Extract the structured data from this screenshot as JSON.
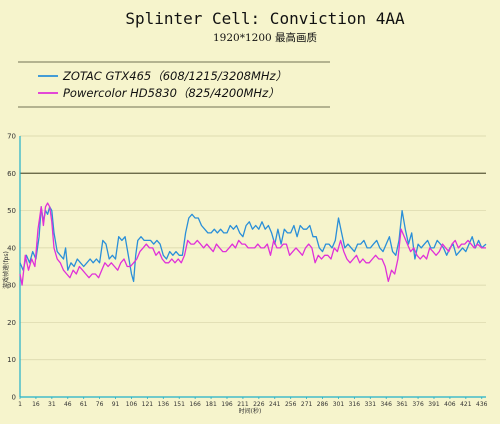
{
  "chart_data": {
    "type": "line",
    "title": "Splinter Cell: Conviction 4AA",
    "subtitle": "1920*1200 最高画质",
    "xlabel": "时间(秒)",
    "ylabel": "游戏帧速(fps)",
    "xlim": [
      1,
      440
    ],
    "ylim": [
      0,
      70
    ],
    "yticks": [
      0,
      10,
      20,
      30,
      40,
      50,
      60,
      70
    ],
    "xtick_labels": [
      "1",
      "16",
      "31",
      "46",
      "61",
      "76",
      "91",
      "106",
      "121",
      "136",
      "151",
      "166",
      "181",
      "196",
      "211",
      "226",
      "241",
      "256",
      "271",
      "286",
      "301",
      "316",
      "331",
      "346",
      "361",
      "376",
      "391",
      "406",
      "421",
      "436"
    ],
    "reference_line": 60,
    "grid": "horizontal",
    "legend_position": "top-left",
    "series": [
      {
        "name": "ZOTAC GTX465（608/1215/3208MHz）",
        "color": "#2a8fd8",
        "points": [
          [
            1,
            36
          ],
          [
            4,
            34
          ],
          [
            7,
            38
          ],
          [
            10,
            36
          ],
          [
            13,
            39
          ],
          [
            16,
            37
          ],
          [
            19,
            43
          ],
          [
            21,
            51
          ],
          [
            23,
            47
          ],
          [
            25,
            50
          ],
          [
            27,
            49
          ],
          [
            29,
            51
          ],
          [
            31,
            50
          ],
          [
            33,
            44
          ],
          [
            36,
            39
          ],
          [
            39,
            38
          ],
          [
            42,
            37
          ],
          [
            44,
            40
          ],
          [
            46,
            34
          ],
          [
            49,
            36
          ],
          [
            52,
            35
          ],
          [
            55,
            37
          ],
          [
            58,
            36
          ],
          [
            61,
            35
          ],
          [
            64,
            36
          ],
          [
            67,
            37
          ],
          [
            70,
            36
          ],
          [
            73,
            37
          ],
          [
            76,
            36
          ],
          [
            79,
            42
          ],
          [
            82,
            41
          ],
          [
            85,
            37
          ],
          [
            88,
            38
          ],
          [
            91,
            37
          ],
          [
            94,
            43
          ],
          [
            97,
            42
          ],
          [
            100,
            43
          ],
          [
            103,
            38
          ],
          [
            106,
            33
          ],
          [
            108,
            31
          ],
          [
            110,
            38
          ],
          [
            112,
            42
          ],
          [
            115,
            43
          ],
          [
            118,
            42
          ],
          [
            121,
            42
          ],
          [
            124,
            42
          ],
          [
            127,
            41
          ],
          [
            130,
            42
          ],
          [
            133,
            41
          ],
          [
            136,
            38
          ],
          [
            139,
            37
          ],
          [
            142,
            39
          ],
          [
            145,
            38
          ],
          [
            148,
            39
          ],
          [
            151,
            38
          ],
          [
            154,
            38
          ],
          [
            157,
            44
          ],
          [
            160,
            48
          ],
          [
            163,
            49
          ],
          [
            166,
            48
          ],
          [
            169,
            48
          ],
          [
            172,
            46
          ],
          [
            175,
            45
          ],
          [
            178,
            44
          ],
          [
            181,
            44
          ],
          [
            184,
            45
          ],
          [
            187,
            44
          ],
          [
            190,
            45
          ],
          [
            193,
            44
          ],
          [
            196,
            44
          ],
          [
            199,
            46
          ],
          [
            202,
            45
          ],
          [
            205,
            46
          ],
          [
            208,
            44
          ],
          [
            211,
            43
          ],
          [
            214,
            46
          ],
          [
            217,
            47
          ],
          [
            220,
            45
          ],
          [
            223,
            46
          ],
          [
            226,
            45
          ],
          [
            229,
            47
          ],
          [
            232,
            45
          ],
          [
            235,
            46
          ],
          [
            238,
            44
          ],
          [
            241,
            41
          ],
          [
            244,
            45
          ],
          [
            247,
            41
          ],
          [
            250,
            45
          ],
          [
            253,
            44
          ],
          [
            256,
            44
          ],
          [
            259,
            46
          ],
          [
            262,
            43
          ],
          [
            265,
            46
          ],
          [
            268,
            45
          ],
          [
            271,
            45
          ],
          [
            274,
            46
          ],
          [
            277,
            43
          ],
          [
            280,
            43
          ],
          [
            283,
            40
          ],
          [
            286,
            39
          ],
          [
            289,
            41
          ],
          [
            292,
            41
          ],
          [
            295,
            40
          ],
          [
            298,
            42
          ],
          [
            301,
            48
          ],
          [
            304,
            44
          ],
          [
            307,
            40
          ],
          [
            310,
            41
          ],
          [
            313,
            40
          ],
          [
            316,
            39
          ],
          [
            319,
            41
          ],
          [
            322,
            41
          ],
          [
            325,
            42
          ],
          [
            328,
            40
          ],
          [
            331,
            40
          ],
          [
            334,
            41
          ],
          [
            337,
            42
          ],
          [
            340,
            40
          ],
          [
            343,
            39
          ],
          [
            346,
            41
          ],
          [
            349,
            43
          ],
          [
            352,
            39
          ],
          [
            355,
            38
          ],
          [
            358,
            42
          ],
          [
            361,
            50
          ],
          [
            364,
            45
          ],
          [
            367,
            41
          ],
          [
            370,
            44
          ],
          [
            373,
            37
          ],
          [
            376,
            41
          ],
          [
            379,
            40
          ],
          [
            382,
            41
          ],
          [
            385,
            42
          ],
          [
            388,
            40
          ],
          [
            391,
            40
          ],
          [
            394,
            42
          ],
          [
            397,
            41
          ],
          [
            400,
            40
          ],
          [
            403,
            38
          ],
          [
            406,
            40
          ],
          [
            409,
            41
          ],
          [
            412,
            38
          ],
          [
            415,
            39
          ],
          [
            418,
            40
          ],
          [
            421,
            39
          ],
          [
            424,
            41
          ],
          [
            427,
            43
          ],
          [
            430,
            40
          ],
          [
            433,
            42
          ],
          [
            436,
            40
          ],
          [
            440,
            41
          ]
        ]
      },
      {
        "name": "Powercolor HD5830（825/4200MHz）",
        "color": "#e030d8",
        "points": [
          [
            1,
            33
          ],
          [
            3,
            30
          ],
          [
            6,
            38
          ],
          [
            9,
            34
          ],
          [
            12,
            37
          ],
          [
            15,
            35
          ],
          [
            18,
            45
          ],
          [
            21,
            51
          ],
          [
            23,
            46
          ],
          [
            25,
            51
          ],
          [
            27,
            52
          ],
          [
            29,
            51
          ],
          [
            31,
            47
          ],
          [
            33,
            40
          ],
          [
            36,
            37
          ],
          [
            39,
            36
          ],
          [
            42,
            34
          ],
          [
            45,
            33
          ],
          [
            48,
            32
          ],
          [
            51,
            34
          ],
          [
            54,
            33
          ],
          [
            57,
            35
          ],
          [
            60,
            34
          ],
          [
            63,
            33
          ],
          [
            66,
            32
          ],
          [
            69,
            33
          ],
          [
            72,
            33
          ],
          [
            75,
            32
          ],
          [
            78,
            34
          ],
          [
            81,
            36
          ],
          [
            84,
            35
          ],
          [
            87,
            36
          ],
          [
            90,
            35
          ],
          [
            93,
            34
          ],
          [
            96,
            36
          ],
          [
            99,
            37
          ],
          [
            102,
            35
          ],
          [
            105,
            35
          ],
          [
            108,
            36
          ],
          [
            111,
            37
          ],
          [
            114,
            39
          ],
          [
            117,
            40
          ],
          [
            120,
            41
          ],
          [
            123,
            40
          ],
          [
            126,
            40
          ],
          [
            129,
            38
          ],
          [
            132,
            39
          ],
          [
            135,
            37
          ],
          [
            138,
            36
          ],
          [
            141,
            36
          ],
          [
            144,
            37
          ],
          [
            147,
            36
          ],
          [
            150,
            37
          ],
          [
            153,
            36
          ],
          [
            156,
            38
          ],
          [
            159,
            42
          ],
          [
            162,
            41
          ],
          [
            165,
            41
          ],
          [
            168,
            42
          ],
          [
            171,
            41
          ],
          [
            174,
            40
          ],
          [
            177,
            41
          ],
          [
            180,
            40
          ],
          [
            183,
            39
          ],
          [
            186,
            41
          ],
          [
            189,
            40
          ],
          [
            192,
            39
          ],
          [
            195,
            39
          ],
          [
            198,
            40
          ],
          [
            201,
            41
          ],
          [
            204,
            40
          ],
          [
            207,
            42
          ],
          [
            210,
            41
          ],
          [
            213,
            41
          ],
          [
            216,
            40
          ],
          [
            219,
            40
          ],
          [
            222,
            40
          ],
          [
            225,
            41
          ],
          [
            228,
            40
          ],
          [
            231,
            40
          ],
          [
            234,
            41
          ],
          [
            237,
            38
          ],
          [
            240,
            42
          ],
          [
            243,
            40
          ],
          [
            246,
            40
          ],
          [
            249,
            41
          ],
          [
            252,
            41
          ],
          [
            255,
            38
          ],
          [
            258,
            39
          ],
          [
            261,
            40
          ],
          [
            264,
            39
          ],
          [
            267,
            38
          ],
          [
            270,
            40
          ],
          [
            273,
            41
          ],
          [
            276,
            40
          ],
          [
            279,
            36
          ],
          [
            282,
            38
          ],
          [
            285,
            37
          ],
          [
            288,
            38
          ],
          [
            291,
            38
          ],
          [
            294,
            37
          ],
          [
            297,
            40
          ],
          [
            300,
            39
          ],
          [
            303,
            42
          ],
          [
            306,
            39
          ],
          [
            309,
            37
          ],
          [
            312,
            36
          ],
          [
            315,
            37
          ],
          [
            318,
            38
          ],
          [
            321,
            36
          ],
          [
            324,
            37
          ],
          [
            327,
            36
          ],
          [
            330,
            36
          ],
          [
            333,
            37
          ],
          [
            336,
            38
          ],
          [
            339,
            37
          ],
          [
            342,
            37
          ],
          [
            345,
            35
          ],
          [
            348,
            31
          ],
          [
            351,
            34
          ],
          [
            354,
            33
          ],
          [
            357,
            37
          ],
          [
            360,
            45
          ],
          [
            363,
            43
          ],
          [
            366,
            41
          ],
          [
            369,
            39
          ],
          [
            372,
            40
          ],
          [
            375,
            38
          ],
          [
            378,
            37
          ],
          [
            381,
            38
          ],
          [
            384,
            37
          ],
          [
            387,
            40
          ],
          [
            390,
            39
          ],
          [
            393,
            38
          ],
          [
            396,
            39
          ],
          [
            399,
            41
          ],
          [
            402,
            40
          ],
          [
            405,
            39
          ],
          [
            408,
            41
          ],
          [
            411,
            42
          ],
          [
            414,
            40
          ],
          [
            417,
            41
          ],
          [
            420,
            41
          ],
          [
            423,
            42
          ],
          [
            426,
            41
          ],
          [
            429,
            40
          ],
          [
            432,
            41
          ],
          [
            436,
            40
          ],
          [
            440,
            40
          ]
        ]
      }
    ]
  }
}
